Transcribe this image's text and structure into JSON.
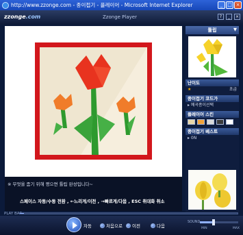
{
  "window": {
    "title": "http://www.zzonge.com - 종이접기 - 플레이어 - Microsoft Internet Explorer",
    "buttons": [
      "_",
      "□",
      "×"
    ]
  },
  "player": {
    "logo_main": "zzonge",
    "logo_domain": ".com",
    "title": "Zzonge Player",
    "header_buttons": [
      "?",
      "_",
      "×"
    ]
  },
  "video": {
    "caption_line1": "※ 무엇을 좀기 위해 평으면 튤립 완성입니다~",
    "caption_line2": "스페이스 자동/수동 전환 , ←느리게/이전 , →빠르게/다음 , ESC 취대화 취소"
  },
  "sidebar": {
    "title": "튤립",
    "difficulty_label": "난이도",
    "difficulty_value": "초급",
    "related_label": "종이접기 코드가",
    "related_dropdown": "▸ 예곡종이선택",
    "skin_label": "플레이어 스킨",
    "skin_colors": [
      "#e8d6a8",
      "#f0a23a",
      "#d8d8d8",
      "#3a3a3a",
      "#ffffff"
    ],
    "guide_label": "종이접기 베스트",
    "guide_value": "▸ 0N"
  },
  "controls": {
    "playbar_label": "PLAY BAR",
    "progress": 0.02,
    "auto_label": "자동",
    "first_label": "처음으로",
    "prev_label": "이전",
    "next_label": "다음",
    "sound_label": "SOUND",
    "volume": 0.35,
    "min_label": "MIN",
    "max_label": "MAX"
  },
  "colors": {
    "frame_red": "#d2171c",
    "tulip_red": "#e8331f",
    "tulip_orange": "#f07c2a",
    "leaf_green": "#3aa33a"
  }
}
